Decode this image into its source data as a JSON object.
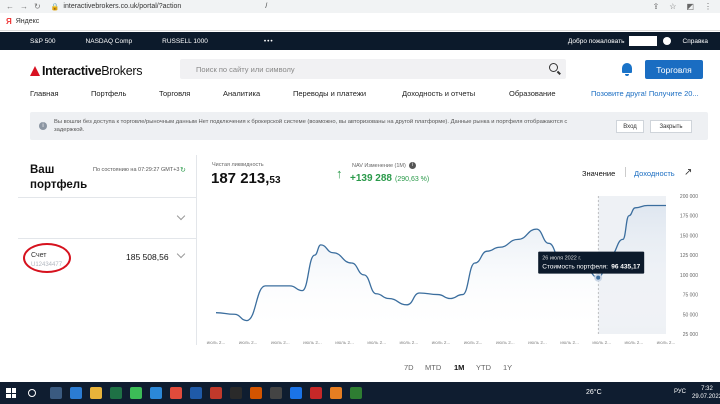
{
  "browser": {
    "url": "interactivebrokers.co.uk/portal/?action",
    "url_tail": "/",
    "bookmark": "Яндекс"
  },
  "ticker": {
    "items": [
      "S&P 500",
      "NASDAQ Comp",
      "RUSSELL 1000"
    ],
    "more": "•••",
    "welcome": "Добро пожаловать",
    "help": "Справка"
  },
  "header": {
    "logo_bold": "Interactive",
    "logo_rest": "Brokers",
    "search_placeholder": "Поиск по сайту или символу",
    "trade_button": "Торговля"
  },
  "nav": {
    "items": [
      "Главная",
      "Портфель",
      "Торговля",
      "Аналитика",
      "Переводы и платежи",
      "Доходность и отчеты",
      "Образование"
    ],
    "promo": "Позовите друга! Получите 20..."
  },
  "notice": {
    "text": "Вы вошли без доступа к торговле/рыночным данным Нет подключения к брокерской системе (возможно, вы авторизованы на другой платформе). Данные рынка и портфеля отображаются с задержкой.",
    "login": "Вход",
    "close": "Закрыть"
  },
  "portfolio": {
    "title": "Ваш портфель",
    "as_of": "По состоянию на 07:29:27 GMT+3",
    "account_label": "Счет",
    "account_number": "U12434477",
    "account_value": "185 508,56"
  },
  "metrics": {
    "liquidity_label": "Чистая ликвидность",
    "liquidity_main": "187 213,",
    "liquidity_cents": "53",
    "nav_label": "NAV Изменение (1M)",
    "nav_change": "+139 288",
    "nav_pct": "(290,63 %)",
    "tab_value": "Значение",
    "tab_return": "Доходность"
  },
  "chart_data": {
    "type": "line",
    "ylim": [
      25000,
      200000
    ],
    "yticks": [
      "200 000",
      "175 000",
      "150 000",
      "125 000",
      "100 000",
      "75 000",
      "50 000",
      "25 000"
    ],
    "xlabels": [
      "июль 2...",
      "июль 2...",
      "июль 2...",
      "июль 2...",
      "июль 2...",
      "июль 2...",
      "июль 2...",
      "июль 2...",
      "июль 2...",
      "июль 2...",
      "июль 2...",
      "июль 2...",
      "июль 2...",
      "июль 2...",
      "июль 2..."
    ],
    "x": [
      0,
      3,
      5,
      8,
      10,
      12,
      14,
      16,
      17,
      19,
      22,
      24,
      26,
      28,
      31,
      33,
      36,
      38,
      40,
      42,
      44,
      46,
      49,
      52,
      54,
      56,
      58,
      60,
      62,
      64,
      66,
      67,
      68,
      70,
      71,
      72,
      73
    ],
    "y": [
      52000,
      50000,
      42000,
      86000,
      86000,
      86000,
      80000,
      125000,
      138000,
      128000,
      115000,
      100000,
      76000,
      70000,
      62000,
      77000,
      75000,
      70000,
      75000,
      115000,
      130000,
      135000,
      145000,
      158000,
      140000,
      118000,
      112000,
      107000,
      96435,
      125000,
      145000,
      175000,
      185000,
      188000,
      188000,
      188000,
      188000
    ],
    "tooltip": {
      "date": "26 июля 2022 г.",
      "label": "Стоимость портфеля:",
      "value": "96 435,17",
      "index": 28
    }
  },
  "periods": [
    "7D",
    "MTD",
    "1M",
    "YTD",
    "1Y"
  ],
  "active_period": "1M",
  "taskbar": {
    "weather": "26°C",
    "lang": "РУС",
    "time": "7:32",
    "date": "29.07.2022"
  }
}
